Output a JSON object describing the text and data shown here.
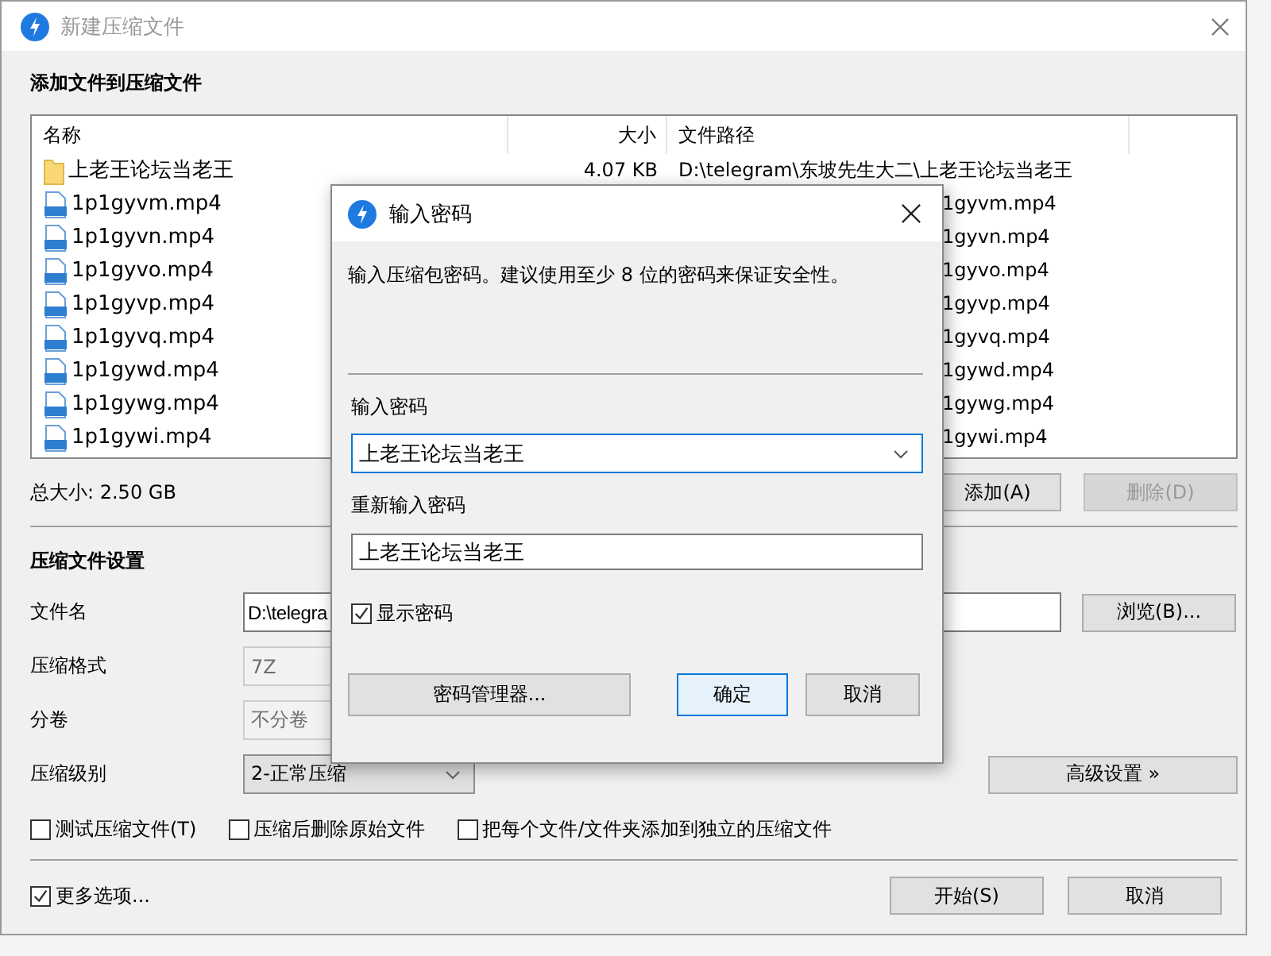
{
  "window": {
    "title": "新建压缩文件"
  },
  "add_section": {
    "heading": "添加文件到压缩文件"
  },
  "file_list": {
    "columns": [
      "名称",
      "大小",
      "文件路径"
    ],
    "rows": [
      {
        "kind": "folder",
        "name": "上老王论坛当老王",
        "size": "4.07 KB",
        "path": "D:\\telegram\\东坡先生大二\\上老王论坛当老王"
      },
      {
        "kind": "video",
        "name": "1p1gyvm.mp4",
        "path": "1gyvm.mp4"
      },
      {
        "kind": "video",
        "name": "1p1gyvn.mp4",
        "path": "1gyvn.mp4"
      },
      {
        "kind": "video",
        "name": "1p1gyvo.mp4",
        "path": "1gyvo.mp4"
      },
      {
        "kind": "video",
        "name": "1p1gyvp.mp4",
        "path": "1gyvp.mp4"
      },
      {
        "kind": "video",
        "name": "1p1gyvq.mp4",
        "path": "1gyvq.mp4"
      },
      {
        "kind": "video",
        "name": "1p1gywd.mp4",
        "path": "1gywd.mp4"
      },
      {
        "kind": "video",
        "name": "1p1gywg.mp4",
        "path": "1gywg.mp4"
      },
      {
        "kind": "video",
        "name": "1p1gywi.mp4",
        "path": "1gywi.mp4"
      }
    ]
  },
  "total_size": "总大小: 2.50 GB",
  "list_buttons": [
    {
      "label": "添加(A)",
      "disabled": false
    },
    {
      "label": "删除(D)",
      "disabled": true
    }
  ],
  "settings": {
    "heading": "压缩文件设置",
    "fields": [
      {
        "kind": "text",
        "label": "文件名",
        "value": "D:\\telegra"
      },
      {
        "kind": "combo",
        "label": "压缩格式",
        "value": "7Z",
        "disabled": true
      },
      {
        "kind": "combo",
        "label": "分卷",
        "value": "不分卷",
        "disabled": true
      },
      {
        "kind": "combo",
        "label": "压缩级别",
        "value": "2-正常压缩",
        "disabled": false
      }
    ]
  },
  "browse_button": "浏览(B)...",
  "advanced_button": "高级设置 »",
  "options": [
    {
      "label": "测试压缩文件(T)",
      "checked": false
    },
    {
      "label": "压缩后删除原始文件",
      "checked": false
    },
    {
      "label": "把每个文件/文件夹添加到独立的压缩文件",
      "checked": false
    }
  ],
  "more_options": {
    "label": "更多选项...",
    "checked": true
  },
  "footer_buttons": [
    "开始(S)",
    "取消"
  ],
  "dialog": {
    "title": "输入密码",
    "description": "输入压缩包密码。建议使用至少 8 位的密码来保证安全性。",
    "password_label": "输入密码",
    "password": "上老王论坛当老王",
    "confirm_label": "重新输入密码",
    "confirm": "上老王论坛当老王",
    "show_password": {
      "label": "显示密码",
      "checked": true
    },
    "buttons": [
      {
        "label": "密码管理器...",
        "default": false
      },
      {
        "label": "确定",
        "default": true
      },
      {
        "label": "取消",
        "default": false
      }
    ]
  }
}
